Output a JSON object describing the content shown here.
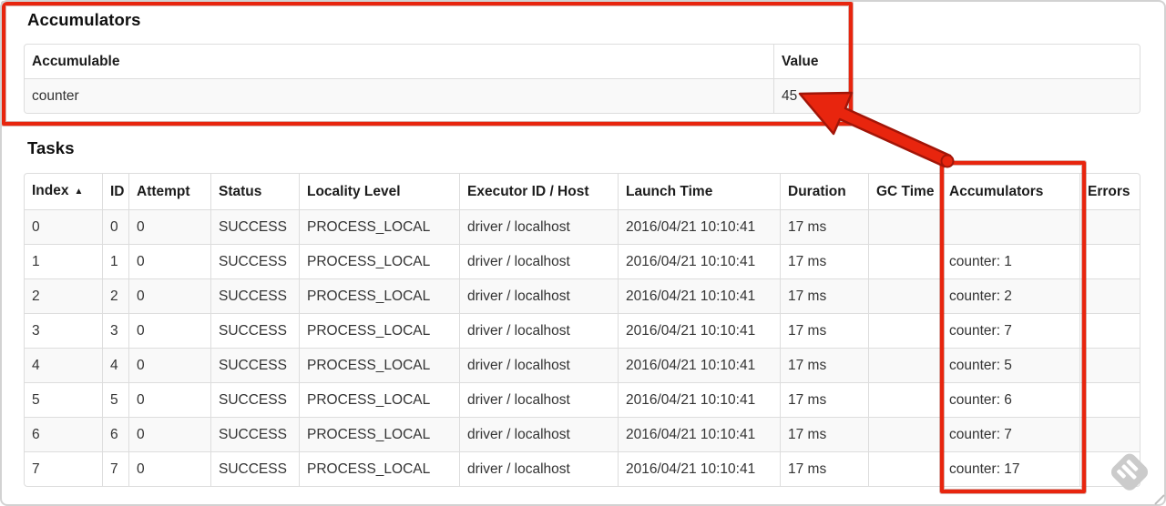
{
  "annotations": {
    "color": "#e8250e",
    "outline_color": "#a21508"
  },
  "accumulators_section": {
    "title": "Accumulators",
    "table": {
      "headers": [
        "Accumulable",
        "Value"
      ],
      "rows": [
        [
          "counter",
          "45"
        ]
      ]
    }
  },
  "tasks_section": {
    "title": "Tasks",
    "table": {
      "sort_icon": "▲",
      "headers": [
        "Index",
        "ID",
        "Attempt",
        "Status",
        "Locality Level",
        "Executor ID / Host",
        "Launch Time",
        "Duration",
        "GC Time",
        "Accumulators",
        "Errors"
      ],
      "rows": [
        [
          "0",
          "0",
          "0",
          "SUCCESS",
          "PROCESS_LOCAL",
          "driver / localhost",
          "2016/04/21 10:10:41",
          "17 ms",
          "",
          "",
          ""
        ],
        [
          "1",
          "1",
          "0",
          "SUCCESS",
          "PROCESS_LOCAL",
          "driver / localhost",
          "2016/04/21 10:10:41",
          "17 ms",
          "",
          "counter: 1",
          ""
        ],
        [
          "2",
          "2",
          "0",
          "SUCCESS",
          "PROCESS_LOCAL",
          "driver / localhost",
          "2016/04/21 10:10:41",
          "17 ms",
          "",
          "counter: 2",
          ""
        ],
        [
          "3",
          "3",
          "0",
          "SUCCESS",
          "PROCESS_LOCAL",
          "driver / localhost",
          "2016/04/21 10:10:41",
          "17 ms",
          "",
          "counter: 7",
          ""
        ],
        [
          "4",
          "4",
          "0",
          "SUCCESS",
          "PROCESS_LOCAL",
          "driver / localhost",
          "2016/04/21 10:10:41",
          "17 ms",
          "",
          "counter: 5",
          ""
        ],
        [
          "5",
          "5",
          "0",
          "SUCCESS",
          "PROCESS_LOCAL",
          "driver / localhost",
          "2016/04/21 10:10:41",
          "17 ms",
          "",
          "counter: 6",
          ""
        ],
        [
          "6",
          "6",
          "0",
          "SUCCESS",
          "PROCESS_LOCAL",
          "driver / localhost",
          "2016/04/21 10:10:41",
          "17 ms",
          "",
          "counter: 7",
          ""
        ],
        [
          "7",
          "7",
          "0",
          "SUCCESS",
          "PROCESS_LOCAL",
          "driver / localhost",
          "2016/04/21 10:10:41",
          "17 ms",
          "",
          "counter: 17",
          ""
        ]
      ]
    }
  },
  "watermark": {
    "name": "feedly-logo",
    "color": "#cbcbcb"
  }
}
